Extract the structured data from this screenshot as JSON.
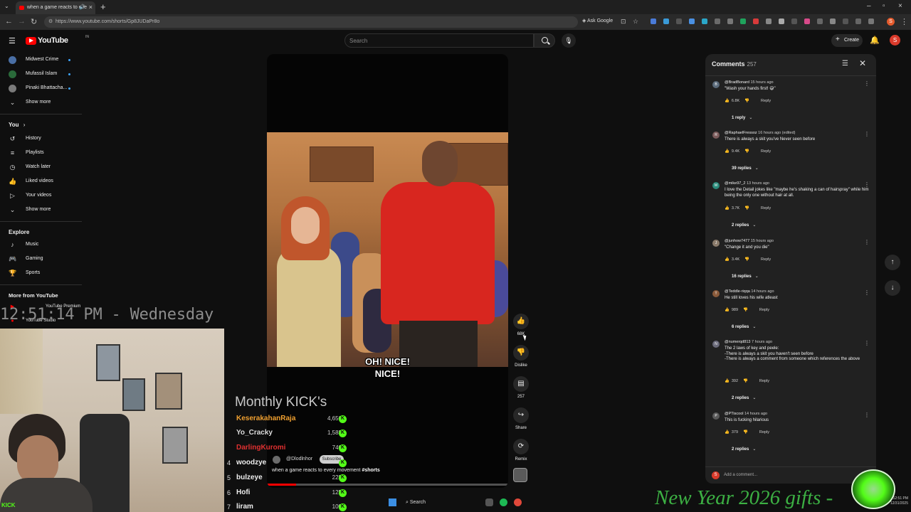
{
  "browser": {
    "tab_title": "when a game reacts to eve",
    "url": "https://www.youtube.com/shorts/Gp8JUDaPr8o",
    "ask_google": "Ask Google"
  },
  "header": {
    "logo_text": "YouTube",
    "logo_region": "IN",
    "search_placeholder": "Search",
    "create_label": "Create",
    "avatar_initial": "S"
  },
  "sidebar": {
    "subscriptions": [
      {
        "label": "Midwest Crime",
        "color": "#4a6fa5"
      },
      {
        "label": "Mufassil Islam",
        "color": "#2a6a3a"
      },
      {
        "label": "Pinaki Bhattacha...",
        "color": "#7a7a7a"
      }
    ],
    "show_more": "Show more",
    "you_label": "You",
    "you_items": [
      "History",
      "Playlists",
      "Watch later",
      "Liked videos",
      "Your videos"
    ],
    "show_more_2": "Show more",
    "explore_label": "Explore",
    "explore_items": [
      "Music",
      "Gaming",
      "Sports"
    ],
    "more_label": "More from YouTube",
    "more_items": [
      "YouTube Premium",
      "YouTube Studio"
    ]
  },
  "overlay": {
    "clock": "12:51:14 PM - Wednesday",
    "kick_title": "Monthly KICK's",
    "kick_rows": [
      {
        "rank": "",
        "name": "KeserakahanRaja",
        "value": "4,656",
        "color": "#f0a030"
      },
      {
        "rank": "",
        "name": "Yo_Cracky",
        "value": "1,588",
        "color": "#dddddd"
      },
      {
        "rank": "",
        "name": "DarlingKuromi",
        "value": "746",
        "color": "#e03030"
      },
      {
        "rank": "4",
        "name": "woodzye",
        "value": "",
        "color": "#eeeeee"
      },
      {
        "rank": "5",
        "name": "bulzeye",
        "value": "228",
        "color": "#eeeeee"
      },
      {
        "rank": "6",
        "name": "Hofi",
        "value": "125",
        "color": "#eeeeee"
      },
      {
        "rank": "7",
        "name": "liram",
        "value": "100",
        "color": "#eeeeee"
      }
    ],
    "gifts_text": "New Year 2026 gifts -",
    "kick_brand": "KICK"
  },
  "player": {
    "caption_line1": "OH! NICE!",
    "caption_line2": "NICE!",
    "channel": "@Dlodlnhor",
    "subscribe": "Subscribe",
    "title": "when a game reacts to every movement",
    "hashtag": "#shorts",
    "progress": 0.12
  },
  "actions": {
    "like_count": "68K",
    "dislike_label": "Dislike",
    "comment_count": "257",
    "share_label": "Share",
    "remix_label": "Remix"
  },
  "comments": {
    "title": "Comments",
    "count": "257",
    "add_placeholder": "Add a comment...",
    "items": [
      {
        "author": "@BradBonard",
        "time": "15 hours ago",
        "text": "\"Wash your hands first! 😅\"",
        "likes": "6.8K",
        "replies": "1 reply",
        "avatar": "B",
        "color": "#5a6a7a"
      },
      {
        "author": "@RaphaelFressoz",
        "time": "16 hours ago (edited)",
        "text": "There is always a skit you've Never seen before",
        "likes": "9.4K",
        "replies": "39 replies",
        "avatar": "R",
        "color": "#7a5a5a"
      },
      {
        "author": "@mike97_2",
        "time": "13 hours ago",
        "text": "I love the Detail jokes like \"maybe he's shaking a can of hairspray\" while him being the only one without hair at all.",
        "likes": "3.7K",
        "replies": "2 replies",
        "avatar": "M",
        "color": "#2a8a7a"
      },
      {
        "author": "@junhow7477",
        "time": "15 hours ago",
        "text": "\"Change it and you die\"",
        "likes": "3.4K",
        "replies": "16 replies",
        "avatar": "J",
        "color": "#8a7a6a"
      },
      {
        "author": "@Teddle-riqqa",
        "time": "14 hours ago",
        "text": "He still loves his wife atleast",
        "likes": "989",
        "replies": "6 replies",
        "avatar": "T",
        "color": "#8a5a3a"
      },
      {
        "author": "@numerqd813",
        "time": "7 hours ago",
        "text": "The 2 laws of key and peele:\n-There is always a skit you haven't seen before\n-There is always a comment from someone which references the above",
        "likes": "392",
        "replies": "2 replies",
        "avatar": "N",
        "color": "#6a6a7a"
      },
      {
        "author": "@PTiscool",
        "time": "14 hours ago",
        "text": "This is fucking hilarious",
        "likes": "379",
        "replies": "2 replies",
        "avatar": "P",
        "color": "#5a5a5a"
      }
    ],
    "reply_label": "Reply"
  },
  "taskbar": {
    "search_label": "Search"
  },
  "system": {
    "time": "12:51 PM",
    "date": "12/31/2025"
  },
  "colors": {
    "accent": "#ff0000",
    "kick_green": "#53fc18",
    "link_blue": "#3ea6ff"
  }
}
